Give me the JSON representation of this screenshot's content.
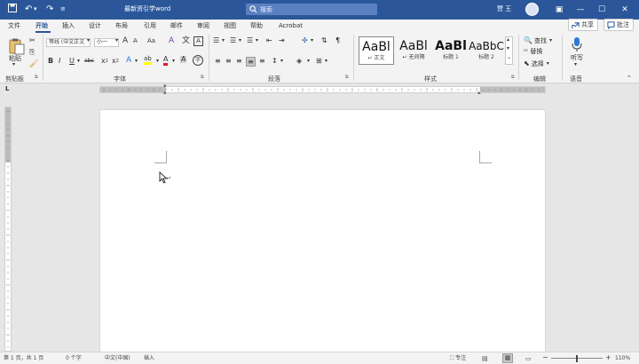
{
  "title_bar": {
    "title": "最新资引学word",
    "search_placeholder": "搜索",
    "user_name": "赞 王",
    "qa_save_icon": "save-icon",
    "qa_undo_icon": "undo-icon",
    "qa_redo_icon": "redo-icon"
  },
  "tabs": [
    "文件",
    "开始",
    "插入",
    "设计",
    "布局",
    "引用",
    "邮件",
    "审阅",
    "视图",
    "帮助",
    "Acrobat"
  ],
  "active_tab": "开始",
  "share": {
    "label": "共享"
  },
  "comments": {
    "label": "批注"
  },
  "clipboard": {
    "paste": "粘贴",
    "group": "剪贴板"
  },
  "font": {
    "font_name": "等线 (中文正文",
    "font_size": "小一",
    "grow_label": "A",
    "shrink_label": "A",
    "case_label": "Aa",
    "clear_label": "A",
    "phonetic_label": "文",
    "border_label": "A",
    "bold": "B",
    "italic": "I",
    "underline": "U",
    "strike": "abc",
    "sub": "x",
    "sup": "x",
    "effects": "A",
    "highlight": "ab",
    "color": "A",
    "shade": "A",
    "circle": "字",
    "group": "字体",
    "highlight_color": "#ffff00",
    "font_color": "#e81123"
  },
  "paragraph": {
    "group": "段落"
  },
  "styles": {
    "items": [
      {
        "sample": "AaBl",
        "name": "正文",
        "prefix": "↵"
      },
      {
        "sample": "AaBl",
        "name": "无间隔",
        "prefix": "↵"
      },
      {
        "sample": "AaBl",
        "name": "标题 1",
        "prefix": ""
      },
      {
        "sample": "AaBbC",
        "name": "标题 2",
        "prefix": ""
      }
    ],
    "group": "样式"
  },
  "editing": {
    "find": "查找",
    "replace": "替换",
    "select": "选择",
    "group": "编辑"
  },
  "voice": {
    "dictate": "听写",
    "group": "语音"
  },
  "ruler_corner": "L",
  "document": {
    "paragraph_mark": "↵"
  },
  "status": {
    "page": "第 1 页，共 1 页",
    "words": "0 个字",
    "language": "中文(中国)",
    "mode": "插入",
    "focus": "专注",
    "zoom": "110%",
    "zoom_minus": "−",
    "zoom_plus": "+",
    "zoom_level": 0.5
  },
  "colors": {
    "brand": "#2b579a"
  }
}
